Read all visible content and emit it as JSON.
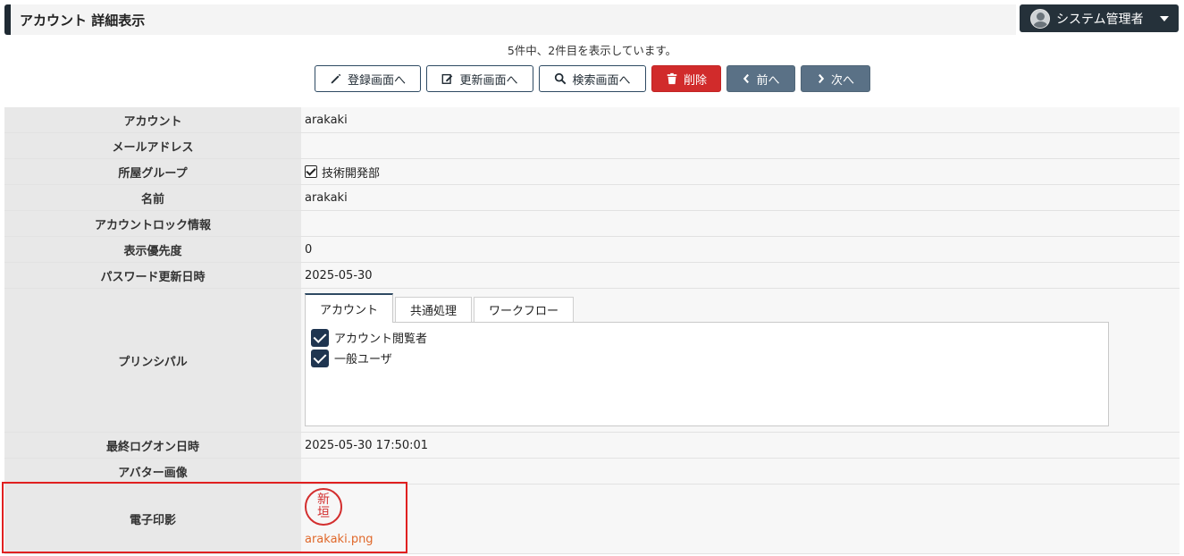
{
  "header": {
    "title": "アカウント 詳細表示",
    "user_label": "システム管理者"
  },
  "record_info": "5件中、2件目を表示しています。",
  "toolbar": {
    "register": "登録画面へ",
    "update": "更新画面へ",
    "search": "検索画面へ",
    "delete": "削除",
    "prev": "前へ",
    "next": "次へ"
  },
  "fields": {
    "account": {
      "label": "アカウント",
      "value": "arakaki"
    },
    "email": {
      "label": "メールアドレス",
      "value": ""
    },
    "group": {
      "label": "所屋グループ",
      "value": "技術開発部"
    },
    "name": {
      "label": "名前",
      "value": "arakaki"
    },
    "lock": {
      "label": "アカウントロック情報",
      "value": ""
    },
    "priority": {
      "label": "表示優先度",
      "value": "0"
    },
    "password_updated": {
      "label": "パスワード更新日時",
      "value": "2025-05-30"
    },
    "principal": {
      "label": "プリンシパル",
      "tabs": [
        "アカウント",
        "共通処理",
        "ワークフロー"
      ],
      "items": [
        "アカウント閲覧者",
        "一般ユーザ"
      ]
    },
    "last_logon": {
      "label": "最終ログオン日時",
      "value": "2025-05-30 17:50:01"
    },
    "avatar": {
      "label": "アバター画像",
      "value": ""
    },
    "seal": {
      "label": "電子印影",
      "seal_chars": [
        "新",
        "垣"
      ],
      "file": "arakaki.png"
    }
  },
  "colors": {
    "required": "#c62828",
    "link_label": "#5c5a8c",
    "danger": "#d12b2b",
    "nav": "#5a7186",
    "dark": "#25313a",
    "highlight": "#e02020"
  }
}
